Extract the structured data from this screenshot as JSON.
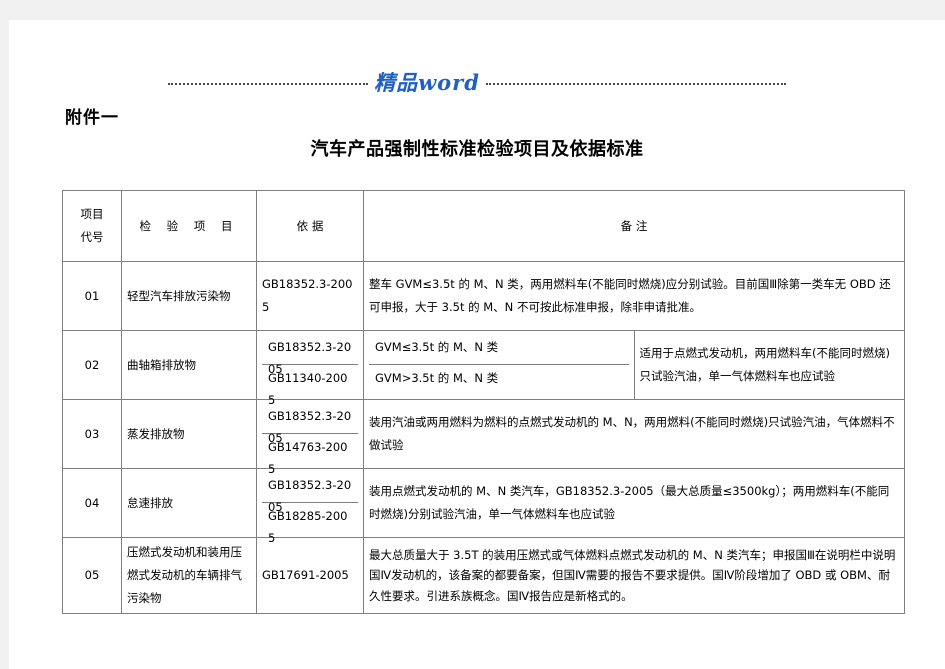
{
  "watermark": {
    "text": "精品word"
  },
  "heading": {
    "attachment_label": "附件一",
    "title": "汽车产品强制性标准检验项目及依据标准"
  },
  "table": {
    "headers": {
      "code_line1": "项目",
      "code_line2": "代号",
      "item": "检 验 项 目",
      "basis": "依  据",
      "remark": "备     注"
    },
    "rows": [
      {
        "code": "01",
        "item": "轻型汽车排放污染物",
        "standards": [
          "GB18352.3-2005"
        ],
        "categories": [],
        "remark": "整车 GVM≤3.5t 的 M、N 类，两用燃料车(不能同时燃烧)应分别试验。目前国Ⅲ除第一类车无 OBD 还可申报，大于 3.5t 的 M、N 不可按此标准申报，除非申请批准。"
      },
      {
        "code": "02",
        "item": "曲轴箱排放物",
        "standards": [
          "GB18352.3-2005",
          "GB11340-2005"
        ],
        "categories": [
          "GVM≤3.5t 的 M、N 类",
          "GVM>3.5t 的 M、N 类"
        ],
        "remark": "适用于点燃式发动机，两用燃料车(不能同时燃烧)只试验汽油，单一气体燃料车也应试验"
      },
      {
        "code": "03",
        "item": "蒸发排放物",
        "standards": [
          "GB18352.3-2005",
          "GB14763-2005"
        ],
        "categories": [],
        "remark": "装用汽油或两用燃料为燃料的点燃式发动机的 M、N，两用燃料(不能同时燃烧)只试验汽油，气体燃料不做试验"
      },
      {
        "code": "04",
        "item": "怠速排放",
        "standards": [
          "GB18352.3-2005",
          "GB18285-2005"
        ],
        "categories": [],
        "remark": "装用点燃式发动机的 M、N 类汽车，GB18352.3-2005（最大总质量≤3500kg）；两用燃料车(不能同时燃烧)分别试验汽油，单一气体燃料车也应试验"
      },
      {
        "code": "05",
        "item": "压燃式发动机和装用压燃式发动机的车辆排气污染物",
        "standards": [
          "GB17691-2005"
        ],
        "categories": [],
        "remark": "最大总质量大于 3.5T 的装用压燃式或气体燃料点燃式发动机的 M、N 类汽车；申报国Ⅲ在说明栏中说明国Ⅳ发动机的，该备案的都要备案，但国Ⅳ需要的报告不要求提供。国Ⅳ阶段增加了 OBD 或 OBM、耐久性要求。引进系族概念。国Ⅳ报告应是新格式的。"
      }
    ]
  }
}
